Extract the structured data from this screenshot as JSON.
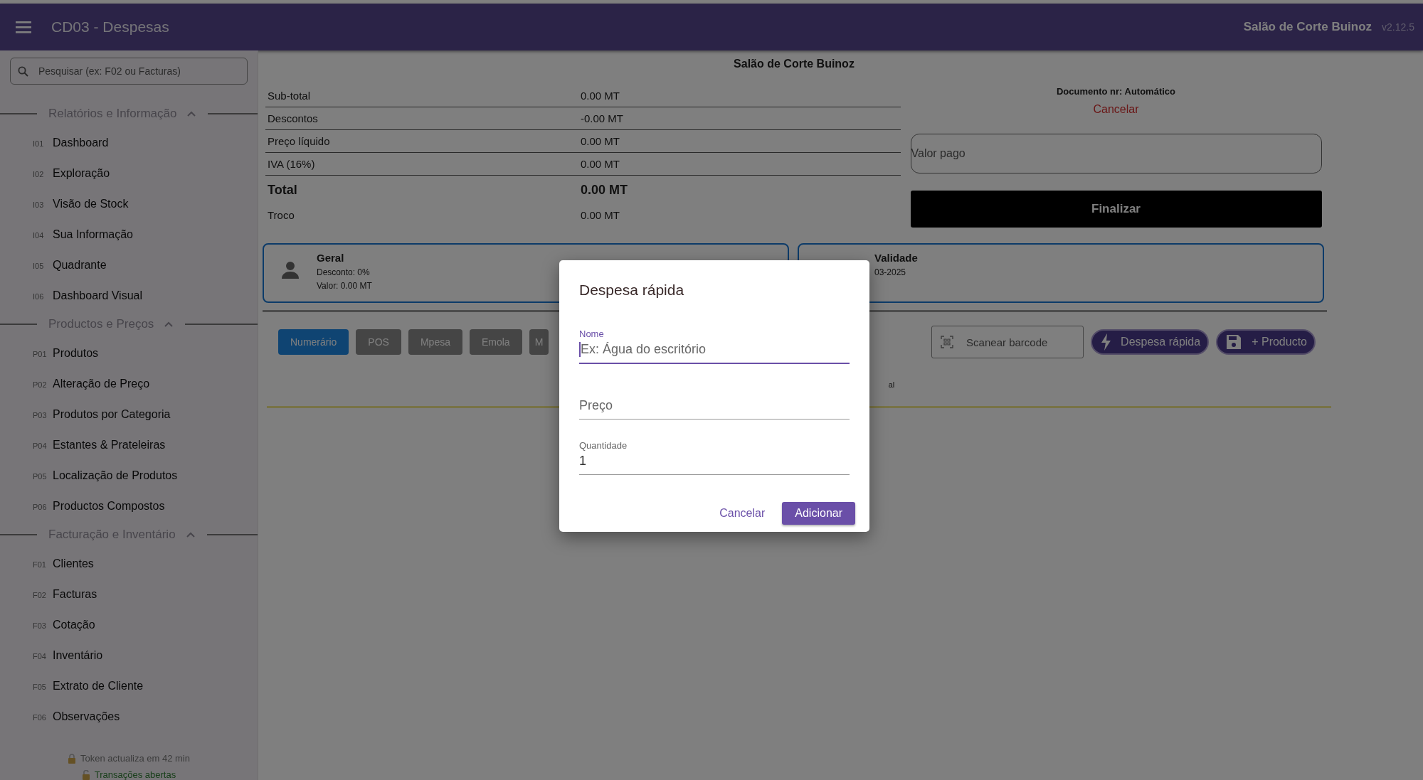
{
  "app_bar": {
    "title": "CD03 - Despesas",
    "company": "Salão de Corte Buinoz",
    "version": "v2.12.5"
  },
  "sidebar": {
    "search": {
      "placeholder": "Pesquisar (ex: F02 ou Facturas)"
    },
    "sections": [
      {
        "title": "Relatórios e Informação",
        "expanded": true,
        "items": [
          {
            "code": "I01",
            "label": "Dashboard"
          },
          {
            "code": "I02",
            "label": "Exploração"
          },
          {
            "code": "I03",
            "label": "Visão de Stock"
          },
          {
            "code": "I04",
            "label": "Sua Informação"
          },
          {
            "code": "I05",
            "label": "Quadrante"
          },
          {
            "code": "I06",
            "label": "Dashboard Visual"
          }
        ]
      },
      {
        "title": "Productos e Preços",
        "expanded": true,
        "items": [
          {
            "code": "P01",
            "label": "Produtos"
          },
          {
            "code": "P02",
            "label": "Alteração de Preço"
          },
          {
            "code": "P03",
            "label": "Produtos por Categoria"
          },
          {
            "code": "P04",
            "label": "Estantes & Prateleiras"
          },
          {
            "code": "P05",
            "label": "Localização de Produtos"
          },
          {
            "code": "P06",
            "label": "Productos Compostos"
          }
        ]
      },
      {
        "title": "Facturação e Inventário",
        "expanded": true,
        "items": [
          {
            "code": "F01",
            "label": "Clientes"
          },
          {
            "code": "F02",
            "label": "Facturas"
          },
          {
            "code": "F03",
            "label": "Cotação"
          },
          {
            "code": "F04",
            "label": "Inventário"
          },
          {
            "code": "F05",
            "label": "Extrato de Cliente"
          },
          {
            "code": "F06",
            "label": "Observações"
          }
        ]
      }
    ],
    "token": "Token actualiza em 42 min",
    "transactions": "Transações abertas"
  },
  "summary": {
    "title": "Salão de Corte Buinoz",
    "rows": [
      {
        "kind": "line",
        "label": "Sub-total",
        "value": "0.00 MT"
      },
      {
        "kind": "line",
        "label": "Descontos",
        "value": "-0.00 MT"
      },
      {
        "kind": "line",
        "label": "Preço líquido",
        "value": "0.00 MT"
      },
      {
        "kind": "line",
        "label": "IVA (16%)",
        "value": "0.00 MT"
      },
      {
        "kind": "total",
        "label": "Total",
        "value": "0.00 MT"
      },
      {
        "kind": "plain",
        "label": "Troco",
        "value": "0.00 MT"
      }
    ]
  },
  "document": {
    "number": "Documento nr: Automático",
    "cancel": "Cancelar",
    "paid": {
      "placeholder": "Valor pago"
    },
    "finish": "Finalizar"
  },
  "cards": [
    {
      "kind": "client",
      "title": "Geral",
      "lines": [
        "Desconto: 0%",
        "Valor: 0.00 MT"
      ]
    },
    {
      "kind": "validity",
      "title": "Validade",
      "lines": [
        "03-2025"
      ]
    }
  ],
  "payment_methods": [
    {
      "label": "Numerário",
      "selected": true
    },
    {
      "label": "POS",
      "selected": false
    },
    {
      "label": "Mpesa",
      "selected": false
    },
    {
      "label": "Emola",
      "selected": false
    },
    {
      "label": "M",
      "selected": false
    }
  ],
  "scan": {
    "placeholder": "Scanear barcode"
  },
  "actions": [
    {
      "kind": "quick",
      "label": "Despesa rápida"
    },
    {
      "kind": "save",
      "label": "+ Producto"
    }
  ],
  "panel_text": "al",
  "dialog": {
    "title": "Despesa rápida",
    "fields": [
      {
        "label": "Nome",
        "placeholder": "Ex: Água do escritório",
        "focused": true
      },
      {
        "placeholder": "Preço",
        "focused": false
      },
      {
        "label": "Quantidade",
        "value": "1",
        "focused": false
      }
    ],
    "buttons": [
      {
        "kind": "text",
        "label": "Cancelar"
      },
      {
        "kind": "filled",
        "label": "Adicionar"
      }
    ]
  }
}
